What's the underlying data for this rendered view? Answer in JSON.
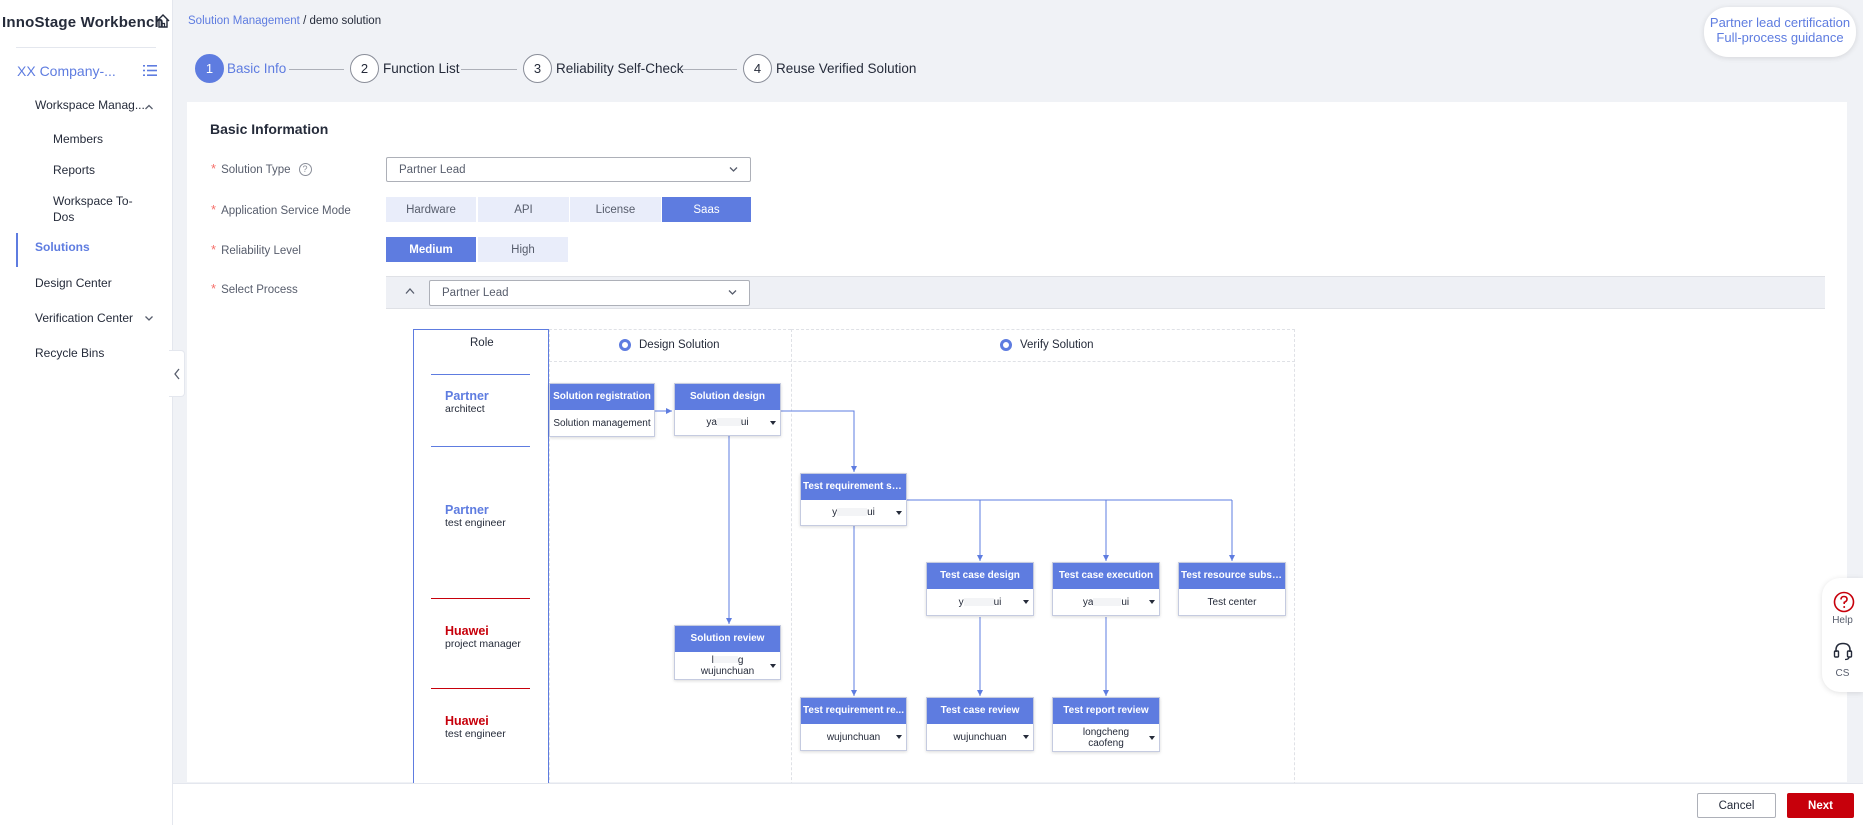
{
  "sidebar": {
    "brand": "InnoStage Workbench",
    "company": "XX Company-...",
    "items": [
      {
        "label": "Workspace Manag..."
      },
      {
        "label": "Members"
      },
      {
        "label": "Reports"
      },
      {
        "label": "Workspace To-",
        "label2": "Dos"
      },
      {
        "label": "Solutions"
      },
      {
        "label": "Design Center"
      },
      {
        "label": "Verification Center"
      },
      {
        "label": "Recycle Bins"
      }
    ]
  },
  "breadcrumb": {
    "parent": "Solution Management",
    "sep": " / ",
    "current": "demo solution"
  },
  "steps": [
    {
      "num": "1",
      "label": "Basic Info"
    },
    {
      "num": "2",
      "label": "Function List"
    },
    {
      "num": "3",
      "label": "Reliability Self-Check"
    },
    {
      "num": "4",
      "label": "Reuse Verified Solution"
    }
  ],
  "partner_card": {
    "line1": "Partner lead certification",
    "line2": "Full-process guidance"
  },
  "form": {
    "section_title": "Basic Information",
    "solution_type": {
      "label": "Solution Type",
      "value": "Partner Lead"
    },
    "service_mode": {
      "label": "Application Service Mode",
      "options": [
        "Hardware",
        "API",
        "License",
        "Saas"
      ],
      "selected": "Saas"
    },
    "reliability": {
      "label": "Reliability Level",
      "options": [
        "Medium",
        "High"
      ],
      "selected": "Medium"
    },
    "process": {
      "label": "Select Process",
      "value": "Partner Lead"
    }
  },
  "diagram": {
    "role_title": "Role",
    "roles": [
      {
        "org": "Partner",
        "title": "architect"
      },
      {
        "org": "Partner",
        "title": "test engineer"
      },
      {
        "org": "Huawei",
        "title": "project manager"
      },
      {
        "org": "Huawei",
        "title": "test engineer"
      }
    ],
    "stages": [
      "Design Solution",
      "Verify Solution"
    ],
    "nodes": {
      "reg": {
        "title": "Solution registration",
        "body": "Solution management"
      },
      "design": {
        "title": "Solution design",
        "body_a": "ya",
        "body_b": "ui"
      },
      "review": {
        "title": "Solution review",
        "body_a": "l",
        "body_b": "g",
        "body2": "wujunchuan"
      },
      "treq": {
        "title": "Test requirement su...",
        "body_a": "y",
        "body_b": "ui"
      },
      "tcd": {
        "title": "Test case design",
        "body_a": "y",
        "body_b": "ui"
      },
      "tce": {
        "title": "Test case execution",
        "body_a": "ya",
        "body_b": "ui"
      },
      "trs": {
        "title": "Test resource subsc...",
        "body": "Test center"
      },
      "treqr": {
        "title": "Test requirement re...",
        "body": "wujunchuan"
      },
      "tcr": {
        "title": "Test case review",
        "body": "wujunchuan"
      },
      "trr": {
        "title": "Test report review",
        "body": "longcheng",
        "body2": "caofeng"
      }
    }
  },
  "float_help": {
    "help": "Help",
    "cs": "CS"
  },
  "footer": {
    "cancel": "Cancel",
    "next": "Next"
  },
  "colors": {
    "accent": "#5e7ce0",
    "danger": "#c7000b",
    "required": "#f66f6a"
  }
}
